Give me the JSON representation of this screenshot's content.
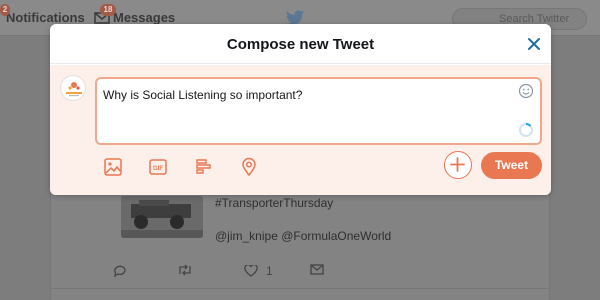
{
  "background": {
    "nav": {
      "notifications_label": "Notifications",
      "notifications_badge": "2",
      "messages_label": "Messages",
      "messages_badge": "18",
      "search_placeholder": "Search Twitter"
    },
    "tweet": {
      "hashtag": "#TransporterThursday",
      "mentions": "@jim_knipe @FormulaOneWorld",
      "like_count": "1"
    }
  },
  "modal": {
    "title": "Compose new Tweet",
    "tweet_text": "Why is Social Listening so important?",
    "tweet_button_label": "Tweet"
  },
  "colors": {
    "accent": "#e97752",
    "compose_background": "#fdefe9",
    "text_box_border": "#f2a88c",
    "close_icon": "#1da1f2"
  },
  "icons": [
    "close-icon",
    "emoji-icon",
    "character-count-ring-icon",
    "image-icon",
    "gif-icon",
    "poll-icon",
    "location-icon",
    "plus-icon",
    "twitter-bird-icon"
  ]
}
